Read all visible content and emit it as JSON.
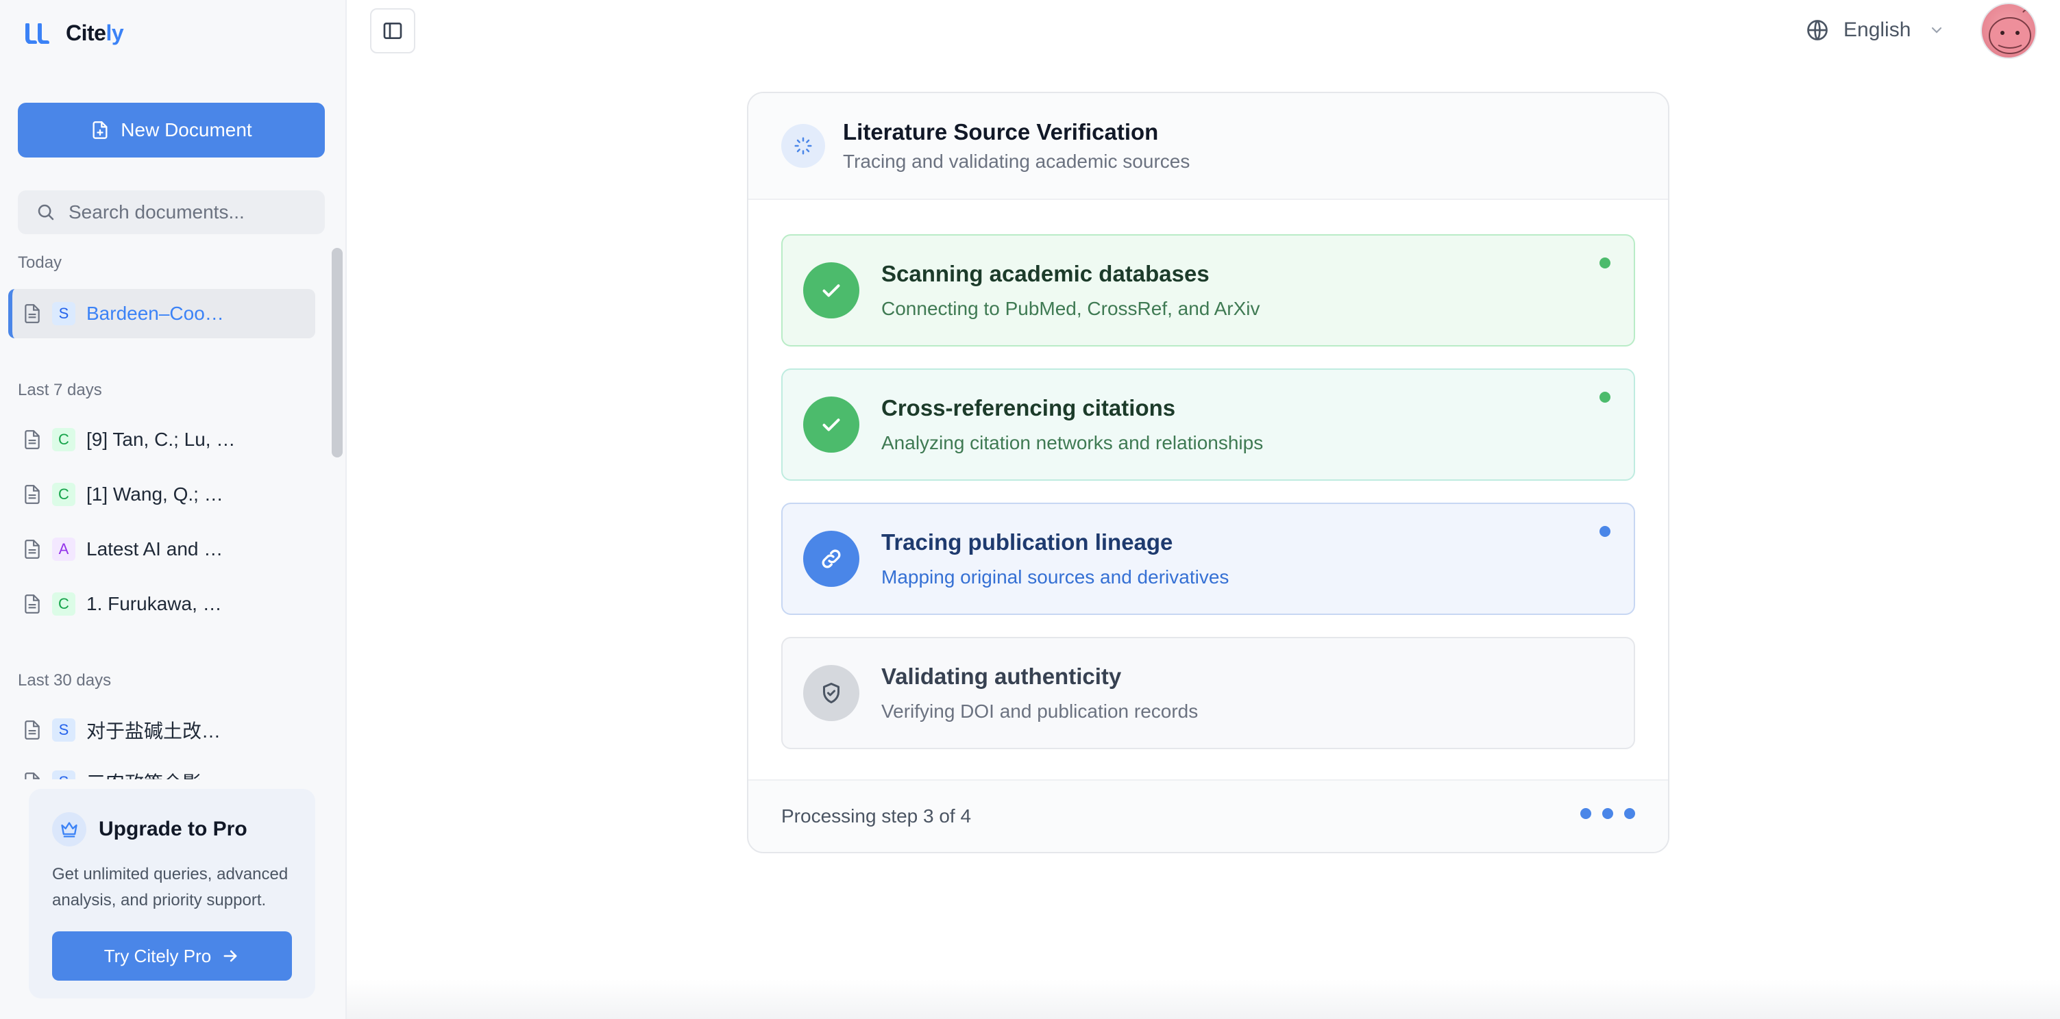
{
  "app": {
    "logo_text_start": "Cite",
    "logo_text_accent": "ly"
  },
  "sidebar": {
    "new_document_label": "New Document",
    "search_placeholder": "Search documents...",
    "groups": [
      {
        "label": "Today",
        "items": [
          {
            "badge": "S",
            "title": "Bardeen–Coo…",
            "active": true
          }
        ]
      },
      {
        "label": "Last 7 days",
        "items": [
          {
            "badge": "C",
            "title": "[9] Tan, C.; Lu, …"
          },
          {
            "badge": "C",
            "title": "[1] Wang, Q.; …"
          },
          {
            "badge": "A",
            "title": "Latest AI and …"
          },
          {
            "badge": "C",
            "title": "1. Furukawa, …"
          }
        ]
      },
      {
        "label": "Last 30 days",
        "items": [
          {
            "badge": "S",
            "title": "对于盐碱土改…"
          },
          {
            "badge": "S",
            "title": "三农政策全影…"
          }
        ]
      }
    ],
    "upgrade": {
      "title": "Upgrade to Pro",
      "description": "Get unlimited queries, advanced analysis, and priority support.",
      "button_label": "Try Citely Pro"
    }
  },
  "topbar": {
    "language": "English"
  },
  "verification": {
    "title": "Literature Source Verification",
    "subtitle": "Tracing and validating academic sources",
    "steps": [
      {
        "title": "Scanning academic databases",
        "description": "Connecting to PubMed, CrossRef, and ArXiv",
        "status": "completed"
      },
      {
        "title": "Cross-referencing citations",
        "description": "Analyzing citation networks and relationships",
        "status": "completed"
      },
      {
        "title": "Tracing publication lineage",
        "description": "Mapping original sources and derivatives",
        "status": "in-progress"
      },
      {
        "title": "Validating authenticity",
        "description": "Verifying DOI and publication records",
        "status": "pending"
      }
    ],
    "footer_text": "Processing step 3 of 4"
  },
  "colors": {
    "accent": "#4a86e8",
    "success": "#4cbb6c"
  },
  "icons": [
    "logo-icon",
    "new-document-icon",
    "search-icon",
    "file-icon",
    "crown-icon",
    "arrow-right-icon",
    "sidebar-toggle-icon",
    "globe-icon",
    "chevron-down-icon",
    "spinner-icon",
    "check-icon",
    "link-icon",
    "shield-icon"
  ]
}
